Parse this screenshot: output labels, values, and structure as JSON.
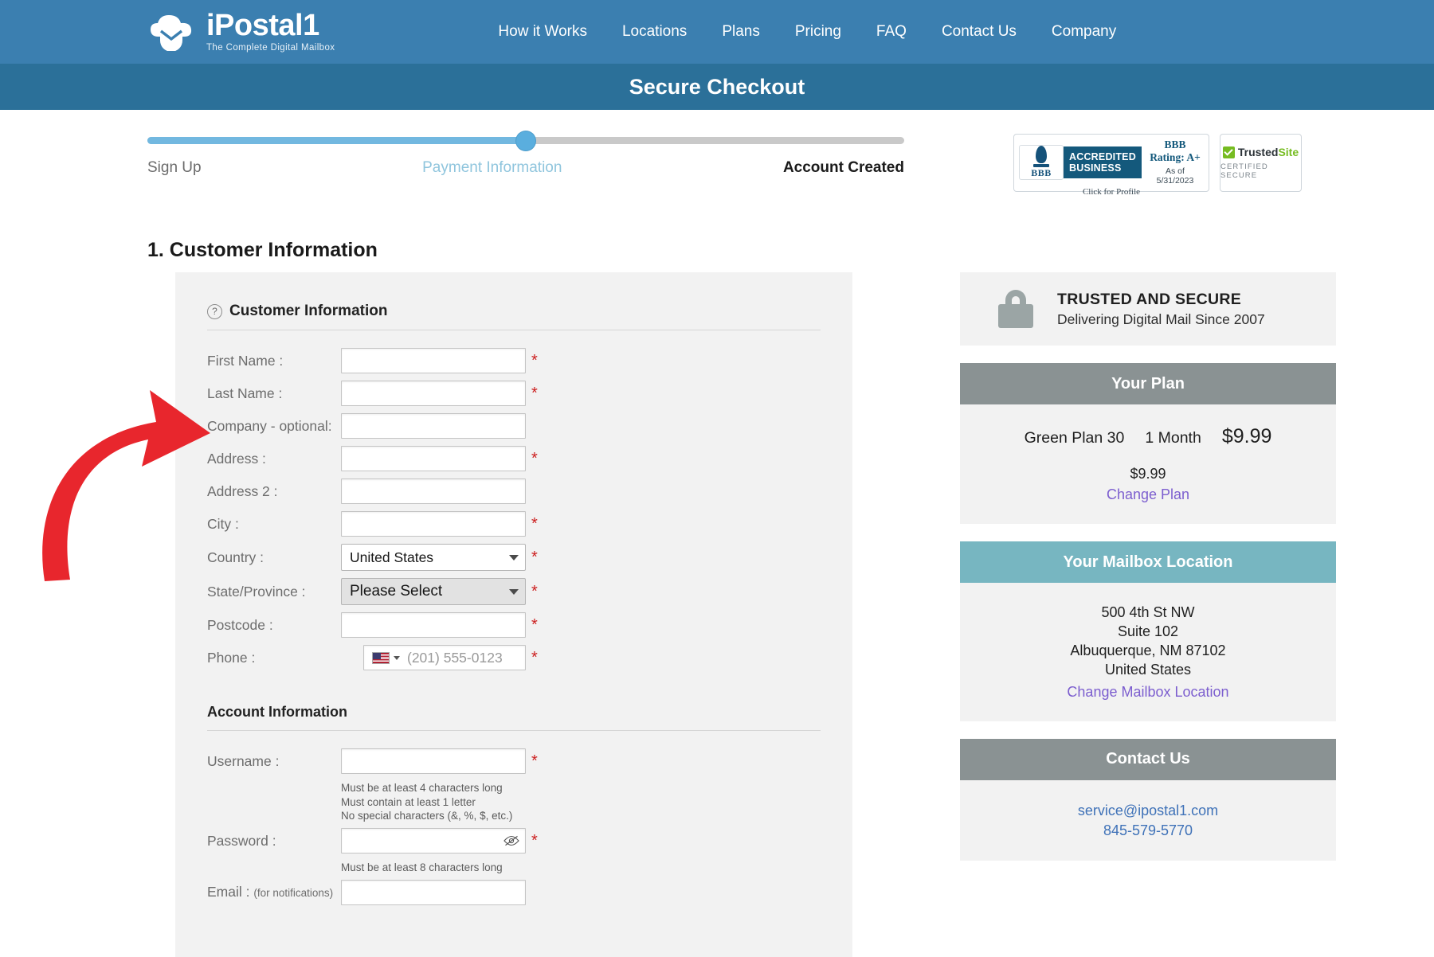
{
  "brand": {
    "logo_text": "iPostal1",
    "logo_tagline": "The Complete Digital Mailbox",
    "nav_color": "#3b7fb0"
  },
  "nav": {
    "items": [
      {
        "label": "How it Works"
      },
      {
        "label": "Locations"
      },
      {
        "label": "Plans"
      },
      {
        "label": "Pricing"
      },
      {
        "label": "FAQ"
      },
      {
        "label": "Contact Us"
      },
      {
        "label": "Company"
      }
    ]
  },
  "checkout_band": {
    "title": "Secure Checkout",
    "color": "#2b7099"
  },
  "progress": {
    "percent": 50,
    "steps": [
      {
        "label": "Sign Up",
        "state": "done"
      },
      {
        "label": "Payment Information",
        "state": "current"
      },
      {
        "label": "Account Created",
        "state": "future"
      }
    ]
  },
  "badges": {
    "bbb": {
      "accredited_line1": "ACCREDITED",
      "accredited_line2": "BUSINESS",
      "seal_text": "BBB",
      "rating": "BBB Rating: A+",
      "as_of": "As of 5/31/2023",
      "click": "Click for Profile"
    },
    "trustedsite": {
      "name_dark": "Trusted",
      "name_green": "Site",
      "subtitle": "CERTIFIED SECURE"
    }
  },
  "section": {
    "heading": "1. Customer Information"
  },
  "customer_form": {
    "panel_title": "Customer Information",
    "help_icon": "question-mark-icon",
    "fields": [
      {
        "label": "First Name :",
        "value": "",
        "required": true,
        "type": "text"
      },
      {
        "label": "Last Name :",
        "value": "",
        "required": true,
        "type": "text"
      },
      {
        "label": "Company - optional:",
        "value": "",
        "required": false,
        "type": "text"
      },
      {
        "label": "Address :",
        "value": "",
        "required": true,
        "type": "text"
      },
      {
        "label": "Address 2 :",
        "value": "",
        "required": false,
        "type": "text"
      },
      {
        "label": "City :",
        "value": "",
        "required": true,
        "type": "text"
      }
    ],
    "country": {
      "label": "Country :",
      "value": "United States",
      "required": true
    },
    "state": {
      "label": "State/Province :",
      "value": "Please Select",
      "required": true
    },
    "postcode": {
      "label": "Postcode :",
      "value": "",
      "required": true
    },
    "phone": {
      "label": "Phone :",
      "placeholder": "(201) 555-0123",
      "required": true,
      "flag": "us-flag-icon"
    }
  },
  "account_form": {
    "panel_title": "Account Information",
    "username": {
      "label": "Username :",
      "value": "",
      "required": true,
      "hints": [
        "Must be at least 4 characters long",
        "Must contain at least 1 letter",
        "No special characters (&, %, $, etc.)"
      ]
    },
    "password": {
      "label": "Password :",
      "value": "",
      "required": true,
      "hint": "Must be at least 8 characters long",
      "toggle_icon": "eye-slash-icon"
    },
    "email": {
      "label": "Email :",
      "label_sub": "(for notifications)",
      "value": "",
      "required": false
    }
  },
  "sidebar": {
    "trusted": {
      "icon": "padlock-icon",
      "title": "TRUSTED AND SECURE",
      "subtitle": "Delivering Digital Mail Since 2007"
    },
    "plan": {
      "header": "Your Plan",
      "name": "Green Plan 30",
      "term": "1 Month",
      "price": "$9.99",
      "total": "$9.99",
      "change_link": "Change Plan",
      "header_color": "#8a9293",
      "link_color": "#7c5ecf"
    },
    "mailbox": {
      "header": "Your Mailbox Location",
      "address_line1": "500 4th St NW",
      "address_line2": "Suite 102",
      "address_line3": "Albuquerque, NM 87102",
      "address_line4": "United States",
      "change_link": "Change Mailbox Location",
      "header_color": "#77b6c1"
    },
    "contact": {
      "header": "Contact Us",
      "email": "service@ipostal1.com",
      "phone": "845-579-5770",
      "header_color": "#8a9293",
      "link_color": "#3f72b8"
    }
  },
  "annotation": {
    "arrow": "red-curved-arrow",
    "color": "#e8262d"
  }
}
